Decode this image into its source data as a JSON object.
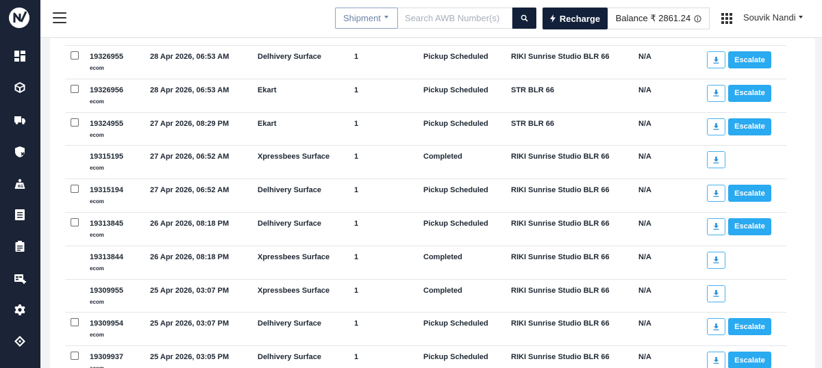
{
  "header": {
    "shipment_label": "Shipment",
    "search_placeholder": "Search AWB Number(s)",
    "recharge_label": "Recharge",
    "balance_text": "Balance ₹ 2861.24",
    "user_name": "Souvik Nandi"
  },
  "sidebar": {
    "icons": [
      "dashboard-icon",
      "box-icon",
      "truck-icon",
      "shield-icon",
      "weight-scale-icon",
      "document-icon",
      "clipboard-icon",
      "add-grid-icon",
      "settings-icon",
      "tag-icon"
    ]
  },
  "colors": {
    "sidebar": "#1b2436",
    "primary_dark": "#13203a",
    "escalate": "#2aaaf0",
    "download_border": "#4ab0ee"
  },
  "orders": [
    {
      "id": "19326955",
      "channel": "ecom",
      "date": "28 Apr 2026, 06:53 AM",
      "courier": "Delhivery Surface",
      "qty": "1",
      "status": "Pickup Scheduled",
      "pickup": "RIKI Sunrise Studio BLR 66",
      "extra": "N/A",
      "checkbox": true,
      "escalate": "Escalate"
    },
    {
      "id": "19326956",
      "channel": "ecom",
      "date": "28 Apr 2026, 06:53 AM",
      "courier": "Ekart",
      "qty": "1",
      "status": "Pickup Scheduled",
      "pickup": "STR BLR 66",
      "extra": "N/A",
      "checkbox": true,
      "escalate": "Escalate"
    },
    {
      "id": "19324955",
      "channel": "ecom",
      "date": "27 Apr 2026, 08:29 PM",
      "courier": "Ekart",
      "qty": "1",
      "status": "Pickup Scheduled",
      "pickup": "STR BLR 66",
      "extra": "N/A",
      "checkbox": true,
      "escalate": "Escalate"
    },
    {
      "id": "19315195",
      "channel": "ecom",
      "date": "27 Apr 2026, 06:52 AM",
      "courier": "Xpressbees Surface",
      "qty": "1",
      "status": "Completed",
      "pickup": "RIKI Sunrise Studio BLR 66",
      "extra": "N/A",
      "checkbox": false,
      "escalate": ""
    },
    {
      "id": "19315194",
      "channel": "ecom",
      "date": "27 Apr 2026, 06:52 AM",
      "courier": "Delhivery Surface",
      "qty": "1",
      "status": "Pickup Scheduled",
      "pickup": "RIKI Sunrise Studio BLR 66",
      "extra": "N/A",
      "checkbox": true,
      "escalate": "Escalate"
    },
    {
      "id": "19313845",
      "channel": "ecom",
      "date": "26 Apr 2026, 08:18 PM",
      "courier": "Delhivery Surface",
      "qty": "1",
      "status": "Pickup Scheduled",
      "pickup": "RIKI Sunrise Studio BLR 66",
      "extra": "N/A",
      "checkbox": true,
      "escalate": "Escalate"
    },
    {
      "id": "19313844",
      "channel": "ecom",
      "date": "26 Apr 2026, 08:18 PM",
      "courier": "Xpressbees Surface",
      "qty": "1",
      "status": "Completed",
      "pickup": "RIKI Sunrise Studio BLR 66",
      "extra": "N/A",
      "checkbox": false,
      "escalate": ""
    },
    {
      "id": "19309955",
      "channel": "ecom",
      "date": "25 Apr 2026, 03:07 PM",
      "courier": "Xpressbees Surface",
      "qty": "1",
      "status": "Completed",
      "pickup": "RIKI Sunrise Studio BLR 66",
      "extra": "N/A",
      "checkbox": false,
      "escalate": ""
    },
    {
      "id": "19309954",
      "channel": "ecom",
      "date": "25 Apr 2026, 03:07 PM",
      "courier": "Delhivery Surface",
      "qty": "1",
      "status": "Pickup Scheduled",
      "pickup": "RIKI Sunrise Studio BLR 66",
      "extra": "N/A",
      "checkbox": true,
      "escalate": "Escalate"
    },
    {
      "id": "19309937",
      "channel": "ecom",
      "date": "25 Apr 2026, 03:05 PM",
      "courier": "Delhivery Surface",
      "qty": "1",
      "status": "Pickup Scheduled",
      "pickup": "RIKI Sunrise Studio BLR 66",
      "extra": "N/A",
      "checkbox": true,
      "escalate": "Escalate"
    }
  ]
}
